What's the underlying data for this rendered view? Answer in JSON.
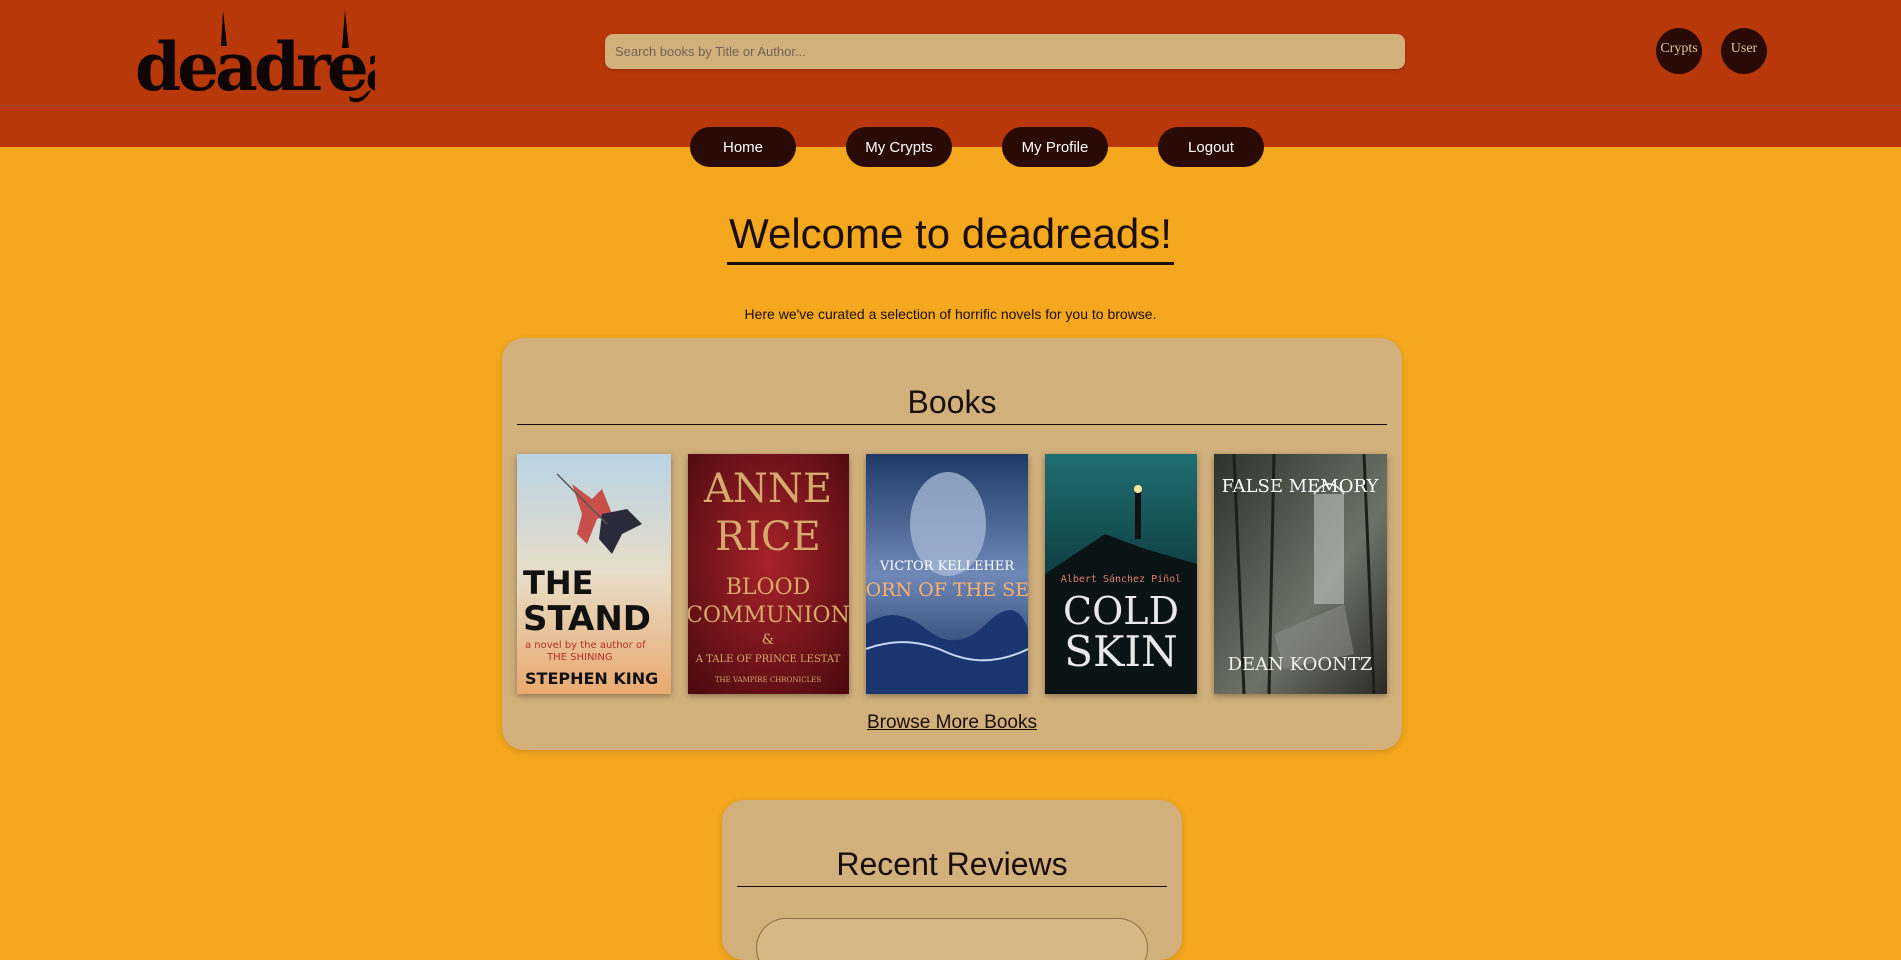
{
  "header": {
    "logo_text": "deadreads",
    "search_placeholder": "Search books by Title or Author...",
    "crypts_button": "Crypts",
    "user_button": "User"
  },
  "nav": {
    "home": "Home",
    "my_crypts": "My Crypts",
    "my_profile": "My Profile",
    "logout": "Logout"
  },
  "main": {
    "welcome_title": "Welcome to deadreads!",
    "tagline": "Here we've curated a selection of horrific novels for you to browse."
  },
  "books": {
    "title": "Books",
    "browse_more": "Browse More Books",
    "items": [
      {
        "cover_lines": [
          "THE",
          "STAND",
          "a novel by the author of",
          "THE SHINING",
          "STEPHEN KING"
        ]
      },
      {
        "cover_lines": [
          "ANNE",
          "RICE",
          "BLOOD",
          "COMMUNION",
          "&",
          "A TALE OF PRINCE LESTAT",
          "THE VAMPIRE CHRONICLES"
        ]
      },
      {
        "cover_lines": [
          "VICTOR KELLEHER",
          "BORN OF THE SEA"
        ]
      },
      {
        "cover_lines": [
          "Albert Sánchez Piñol",
          "COLD",
          "SKIN"
        ]
      },
      {
        "cover_lines": [
          "FALSE MEMORY",
          "DEAN KOONTZ"
        ]
      }
    ]
  },
  "reviews": {
    "title": "Recent Reviews"
  },
  "colors": {
    "header_bg": "#b9380a",
    "page_bg": "#f5a81e",
    "panel_bg": "#d2b07c",
    "button_bg": "#2a0a05"
  }
}
